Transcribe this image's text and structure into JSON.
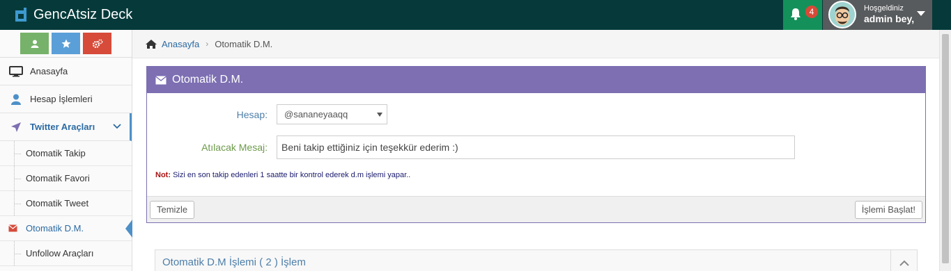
{
  "navbar": {
    "brand": "GencAtsiz Deck",
    "notification_count": "4",
    "user_greeting": "Hoşgeldiniz",
    "user_name": "admin bey,"
  },
  "sidebar": {
    "shortcut_buttons": [
      {
        "icon": "user-icon",
        "color": "#77b26a"
      },
      {
        "icon": "star-icon",
        "color": "#5b9fd8"
      },
      {
        "icon": "cogs-icon",
        "color": "#d64b3a"
      }
    ],
    "items": [
      {
        "label": "Anasayfa",
        "icon": "desktop-icon"
      },
      {
        "label": "Hesap İşlemleri",
        "icon": "user-icon"
      },
      {
        "label": "Twitter Araçları",
        "icon": "paper-plane-icon",
        "open": true
      }
    ],
    "sub_items": [
      {
        "label": "Otomatik Takip"
      },
      {
        "label": "Otomatik Favori"
      },
      {
        "label": "Otomatik Tweet"
      },
      {
        "label": "Otomatik D.M.",
        "active": true
      },
      {
        "label": "Unfollow Araçları"
      }
    ]
  },
  "breadcrumb": {
    "home": "Anasayfa",
    "current": "Otomatik D.M."
  },
  "panel": {
    "title": "Otomatik D.M.",
    "account_label": "Hesap:",
    "account_value": "@sananeyaaqq",
    "message_label": "Atılacak Mesaj:",
    "message_value": "Beni takip ettiğiniz için teşekkür ederim :)",
    "note_key": "Not:",
    "note_text": "Sizi en son takip edenleri 1 saatte bir kontrol ederek d.m işlemi yapar..",
    "clear_button": "Temizle",
    "start_button": "İşlemi Başlat!"
  },
  "section": {
    "title": "Otomatik D.M İşlemi ( 2 ) İşlem"
  },
  "colors": {
    "navbar": "#063a3a",
    "panel_header": "#7d6fb2",
    "accent_blue": "#2b6aa3",
    "notification_green": "#14915a"
  }
}
